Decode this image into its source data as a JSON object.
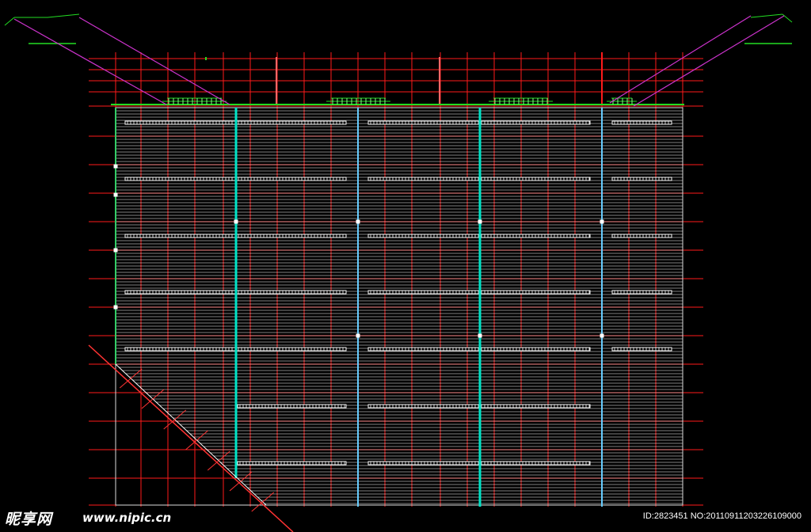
{
  "watermark": {
    "logo_text": "昵享网",
    "url_text": "www.nipic.cn",
    "id_text": "ID:2823451 NO:20110911203226109000"
  },
  "drawing": {
    "background": "#000000",
    "grid_color": "#ff1a1a",
    "slab_line_color": "#ffffff",
    "column_cyan_color": "#00e5c8",
    "column_blue_color": "#66ccff",
    "roof_green_color": "#22dd22",
    "brace_magenta_color": "#cc33cc",
    "dimension_red_color": "#ff3333"
  }
}
